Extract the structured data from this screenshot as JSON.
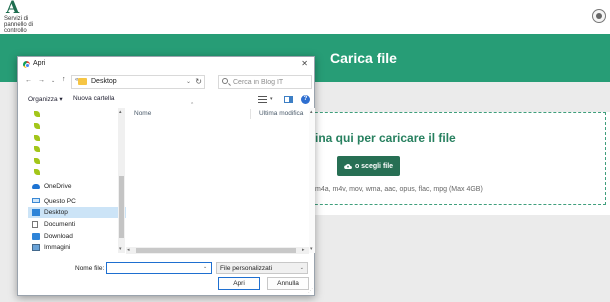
{
  "page": {
    "logo_letter": "A",
    "logo_subtitle": "Servizi di pannello di controllo",
    "hero_title": "Carica file",
    "drop_text": "ina qui per caricare il file",
    "choose_button": "o scegli file",
    "formats_text": "m4a, m4v, mov, wma, aac, opus, flac, mpg (Max 4GB)",
    "accent_color": "#279d76"
  },
  "dialog": {
    "title": "Apri",
    "close_glyph": "✕",
    "address": {
      "separator": "«",
      "path": "Desktop"
    },
    "search": {
      "placeholder": "Cerca in Blog IT"
    },
    "toolbar": {
      "organize": "Organizza ▾",
      "new_folder": "Nuova cartella"
    },
    "columns": {
      "name": "Nome",
      "modified": "Ultima modifica"
    },
    "tree": [
      {
        "label": "OneDrive",
        "icon": "onedrive-icon"
      },
      {
        "label": "Questo PC",
        "icon": "computer-icon"
      },
      {
        "label": "Desktop",
        "icon": "desktop-icon",
        "selected": true
      },
      {
        "label": "Documenti",
        "icon": "documents-icon"
      },
      {
        "label": "Download",
        "icon": "download-icon"
      },
      {
        "label": "Immagini",
        "icon": "pictures-icon"
      }
    ],
    "filename_label": "Nome file:",
    "filename_value": "",
    "filetype": "File personalizzati",
    "open_button": "Apri",
    "cancel_button": "Annulla"
  }
}
